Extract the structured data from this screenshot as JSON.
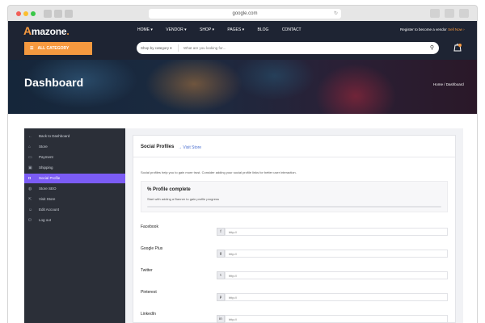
{
  "browser": {
    "url": "google.com",
    "reload_icon": "reload-icon"
  },
  "header": {
    "logo_first": "A",
    "logo_rest": "mazone",
    "logo_dot": ".",
    "menu": [
      "HOME ▾",
      "VENDOR ▾",
      "SHOP ▾",
      "PAGES ▾",
      "BLOG",
      "CONTACT"
    ],
    "register_text": "Register to become a vendor",
    "register_link": "Sell Now ›"
  },
  "searchbar": {
    "all_category": "ALL CATEGORY",
    "select_category": "Shop by category",
    "search_placeholder": "What are you looking for...",
    "cart_count": "0"
  },
  "banner": {
    "title": "Dashboard",
    "breadcrumb": "Home / Dashboard"
  },
  "sidebar": {
    "items": [
      {
        "label": "Back to Dashboard",
        "icon": "arrow-left-icon"
      },
      {
        "label": "Store",
        "icon": "store-icon"
      },
      {
        "label": "Payment",
        "icon": "payment-icon"
      },
      {
        "label": "Shipping",
        "icon": "shipping-icon"
      },
      {
        "label": "Social Profile",
        "icon": "social-icon",
        "active": true
      },
      {
        "label": "Store SEO",
        "icon": "globe-icon"
      },
      {
        "label": "Visit Store",
        "icon": "share-icon"
      },
      {
        "label": "Edit Account",
        "icon": "user-icon"
      },
      {
        "label": "Log out",
        "icon": "power-icon"
      }
    ]
  },
  "social": {
    "title": "Social Profiles",
    "visit_link": "→ Visit Store",
    "description": "Social profiles help you to gain more trust. Consider adding your social profile links for better user interaction.",
    "progress_title": "% Profile complete",
    "progress_subtitle": "Start with adding a Banner to gain profile progress",
    "progress_value": 0,
    "fields": [
      {
        "label": "Facebook",
        "placeholder": "http://",
        "icon": "facebook-icon"
      },
      {
        "label": "Google Plus",
        "placeholder": "http://",
        "icon": "google-plus-icon"
      },
      {
        "label": "Twitter",
        "placeholder": "http://",
        "icon": "twitter-icon"
      },
      {
        "label": "Pinterest",
        "placeholder": "http://",
        "icon": "pinterest-icon"
      },
      {
        "label": "LinkedIn",
        "placeholder": "http://",
        "icon": "linkedin-icon"
      }
    ]
  }
}
